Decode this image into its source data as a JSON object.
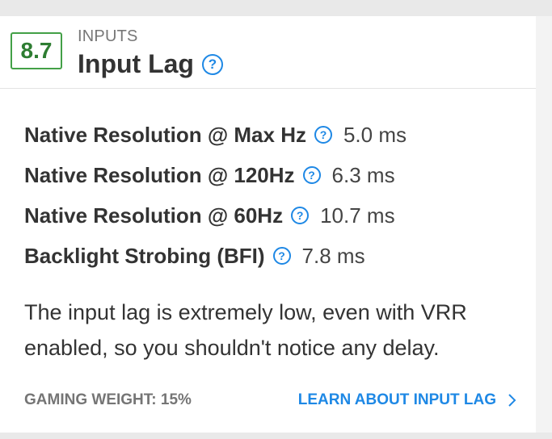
{
  "header": {
    "score": "8.7",
    "category": "INPUTS",
    "title": "Input Lag",
    "help_icon": "question-circle-icon"
  },
  "metrics": [
    {
      "label": "Native Resolution @ Max Hz",
      "value": "5.0 ms",
      "icon": "question-circle-icon"
    },
    {
      "label": "Native Resolution @ 120Hz",
      "value": "6.3 ms",
      "icon": "question-circle-icon"
    },
    {
      "label": "Native Resolution @ 60Hz",
      "value": "10.7 ms",
      "icon": "question-circle-icon"
    },
    {
      "label": "Backlight Strobing (BFI)",
      "value": "7.8 ms",
      "icon": "question-circle-icon"
    }
  ],
  "description": "The input lag is extremely low, even with VRR enabled, so you shouldn't notice any delay.",
  "footer": {
    "gaming_weight": "GAMING WEIGHT: 15%",
    "learn_link": "LEARN ABOUT INPUT LAG",
    "link_icon": "chevron-right-icon"
  },
  "colors": {
    "score_green": "#43a047",
    "accent_blue": "#1e88e5",
    "muted_gray": "#757575"
  }
}
